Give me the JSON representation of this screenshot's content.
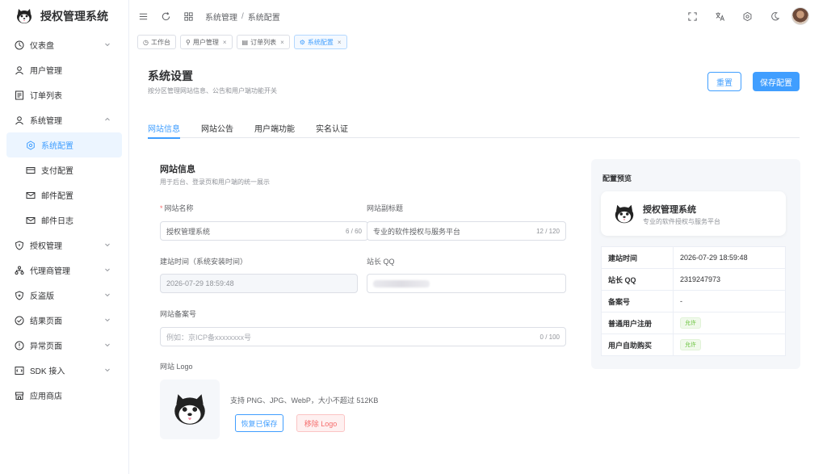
{
  "brand": {
    "name": "授权管理系统"
  },
  "sidebar": {
    "items": [
      {
        "label": "仪表盘",
        "icon": "dashboard-icon",
        "chevron": true
      },
      {
        "label": "用户管理",
        "icon": "user-icon",
        "chevron": false
      },
      {
        "label": "订单列表",
        "icon": "list-icon",
        "chevron": false
      },
      {
        "label": "系统管理",
        "icon": "user-icon",
        "chevron": true,
        "expanded": true
      },
      {
        "label": "系统配置",
        "icon": "gear-icon",
        "sub": true,
        "active": true
      },
      {
        "label": "支付配置",
        "icon": "card-icon",
        "sub": true
      },
      {
        "label": "邮件配置",
        "icon": "mail-icon",
        "sub": true
      },
      {
        "label": "邮件日志",
        "icon": "mail-icon",
        "sub": true
      },
      {
        "label": "授权管理",
        "icon": "shield-icon",
        "chevron": true
      },
      {
        "label": "代理商管理",
        "icon": "network-icon",
        "chevron": true
      },
      {
        "label": "反盗版",
        "icon": "shield-icon",
        "chevron": true
      },
      {
        "label": "结果页面",
        "icon": "check-circle-icon",
        "chevron": true
      },
      {
        "label": "异常页面",
        "icon": "warning-circle-icon",
        "chevron": true
      },
      {
        "label": "SDK 接入",
        "icon": "code-icon",
        "chevron": true
      },
      {
        "label": "应用商店",
        "icon": "store-icon",
        "chevron": false
      }
    ]
  },
  "breadcrumb": {
    "parent": "系统管理",
    "current": "系统配置"
  },
  "tags": [
    {
      "label": "工作台",
      "icon": "dashboard-icon",
      "closable": false
    },
    {
      "label": "用户管理",
      "icon": "user-icon",
      "closable": true
    },
    {
      "label": "订单列表",
      "icon": "list-icon",
      "closable": true
    },
    {
      "label": "系统配置",
      "icon": "gear-icon",
      "closable": true,
      "active": true
    }
  ],
  "page": {
    "title": "系统设置",
    "subtitle": "按分区管理网站信息、公告和用户端功能开关",
    "reset_label": "重置",
    "save_label": "保存配置"
  },
  "tabs": [
    "网站信息",
    "网站公告",
    "用户端功能",
    "实名认证"
  ],
  "form": {
    "section_title": "网站信息",
    "section_subtitle": "用于后台、登录页和用户端的统一展示",
    "site_name_label": "网站名称",
    "site_name_value": "授权管理系统",
    "site_name_count": "6 / 60",
    "site_subtitle_label": "网站副标题",
    "site_subtitle_value": "专业的软件授权与服务平台",
    "site_subtitle_count": "12 / 120",
    "build_time_label": "建站时间（系统安装时间）",
    "build_time_value": "2026-07-29 18:59:48",
    "owner_qq_label": "站长 QQ",
    "icp_label": "网站备案号",
    "icp_placeholder": "例如：京ICP备xxxxxxxx号",
    "icp_count": "0 / 100",
    "logo_label": "网站 Logo",
    "logo_hint": "支持 PNG、JPG、WebP，大小不超过 512KB",
    "restore_label": "恢复已保存",
    "remove_label": "移除 Logo"
  },
  "preview": {
    "title": "配置预览",
    "site_name": "授权管理系统",
    "site_subtitle": "专业的软件授权与服务平台",
    "rows": [
      {
        "k": "建站时间",
        "v": "2026-07-29 18:59:48"
      },
      {
        "k": "站长 QQ",
        "v": "2319247973"
      },
      {
        "k": "备案号",
        "v": "-"
      },
      {
        "k": "普通用户注册",
        "v": "允许",
        "badge": true
      },
      {
        "k": "用户自助购买",
        "v": "允许",
        "badge": true
      }
    ]
  },
  "colors": {
    "accent": "#409eff",
    "danger": "#f56c6c",
    "success": "#67c23a"
  }
}
